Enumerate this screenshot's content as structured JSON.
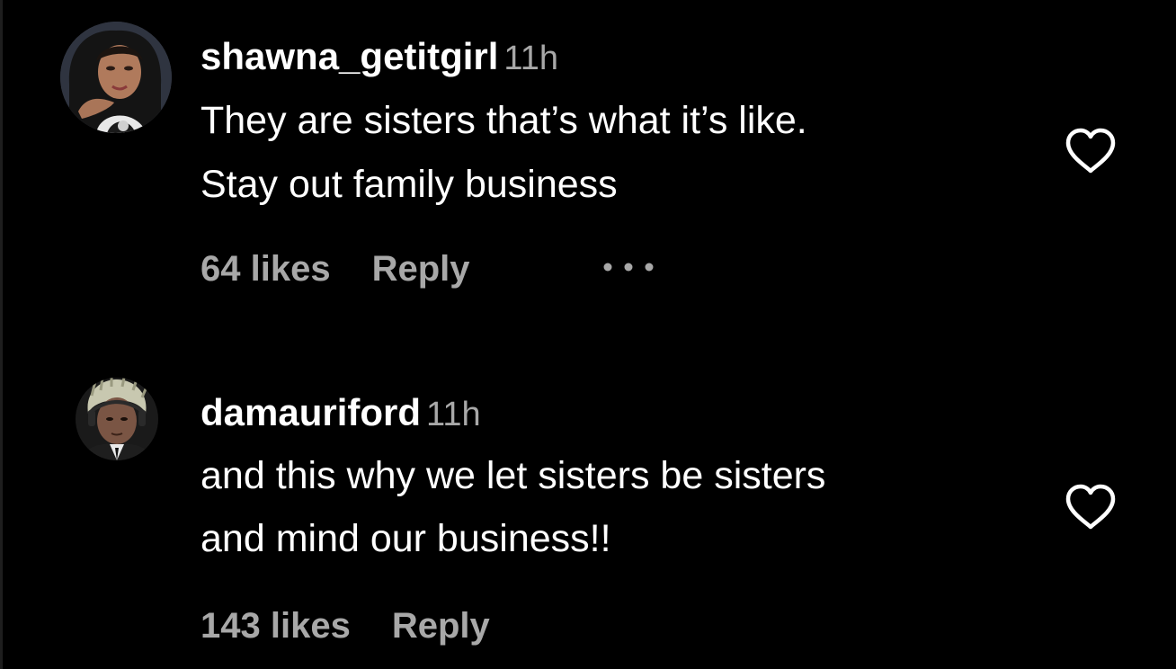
{
  "comments": [
    {
      "username": "shawna_getitgirl",
      "time": "11h",
      "lines": [
        "They are sisters that’s what it’s like.",
        "Stay out family business"
      ],
      "likes": "64 likes",
      "reply": "Reply",
      "avatar_icon": "profile-photo-woman",
      "has_more": true
    },
    {
      "username": "damauriford",
      "time": "11h",
      "lines": [
        "and this why we let sisters be sisters",
        "and mind our business!!"
      ],
      "likes": "143 likes",
      "reply": "Reply",
      "avatar_icon": "profile-photo-man",
      "has_more": false
    }
  ],
  "icons": {
    "like": "heart-outline-icon",
    "more": "more-horizontal-icon"
  },
  "colors": {
    "background": "#000000",
    "primary_text": "#ffffff",
    "secondary_text": "#a8a8a8"
  }
}
